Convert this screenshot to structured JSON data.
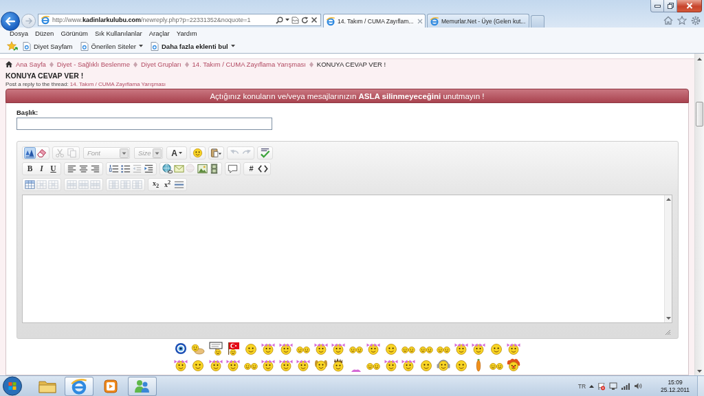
{
  "browser": {
    "back": {
      "disabled": false
    },
    "forward": {
      "disabled": true
    },
    "address": "http://www.**kadinlarkulubu.com**/newreply.php?p=22331352&noquote=1",
    "tabs": [
      {
        "label": "14. Takım / CUMA Zayıflam...",
        "selected": true
      },
      {
        "label": "Memurlar.Net - Üye (Gelen kut...",
        "selected": false
      }
    ],
    "menu": [
      "Dosya",
      "Düzen",
      "Görünüm",
      "Sık Kullanılanlar",
      "Araçlar",
      "Yardım"
    ],
    "favorites": [
      {
        "label": "Diyet Sayfam",
        "dropdown": false,
        "bold": false
      },
      {
        "label": "Önerilen Siteler",
        "dropdown": true,
        "bold": false
      },
      {
        "label": "Daha fazla eklenti bul",
        "dropdown": true,
        "bold": true
      }
    ]
  },
  "page": {
    "breadcrumb": [
      {
        "label": "Ana Sayfa",
        "current": false
      },
      {
        "label": "Diyet - Sağlıklı Beslenme",
        "current": false
      },
      {
        "label": "Diyet Grupları",
        "current": false
      },
      {
        "label": "14. Takım / CUMA Zayıflama Yarışması",
        "current": false
      },
      {
        "label": "KONUYA CEVAP VER !",
        "current": true
      }
    ],
    "title": "KONUYA CEVAP VER !",
    "subtitle": {
      "text": "Post a reply to the thread:",
      "link": "14. Takım / CUMA Zayıflama Yarışması"
    },
    "notice": "Açtığınız konuların ve/veya mesajlarınızın **ASLA silinmeyeceğini** unutmayın !",
    "form": {
      "title_label": "Başlık:"
    },
    "editor": {
      "toolbar": [
        [
          [
            {
              "kind": "mode",
              "on": true,
              "disabled": false
            },
            {
              "kind": "removeformat",
              "on": false,
              "disabled": false
            }
          ],
          [
            {
              "kind": "cut",
              "on": false,
              "disabled": true
            },
            {
              "kind": "copy",
              "on": false,
              "disabled": true
            }
          ],
          [
            {
              "kind": "font_select",
              "text": "Font",
              "on": false,
              "disabled": false
            }
          ],
          [
            {
              "kind": "size_select",
              "text": "Size",
              "on": false,
              "disabled": false
            }
          ],
          [
            {
              "kind": "color",
              "text": "A",
              "on": false,
              "disabled": false
            }
          ],
          [
            {
              "kind": "smiley",
              "on": false,
              "disabled": false
            }
          ],
          [
            {
              "kind": "paste",
              "on": false,
              "disabled": false
            }
          ],
          [
            {
              "kind": "undo",
              "on": false,
              "disabled": true
            },
            {
              "kind": "redo",
              "on": false,
              "disabled": true
            }
          ],
          [
            {
              "kind": "spellcheck",
              "on": false,
              "disabled": false
            }
          ]
        ],
        [
          [
            {
              "kind": "bold",
              "text": "B",
              "on": false,
              "disabled": false
            },
            {
              "kind": "italic",
              "text": "I",
              "on": false,
              "disabled": false
            },
            {
              "kind": "underline",
              "text": "U",
              "on": false,
              "disabled": false
            }
          ],
          [
            {
              "kind": "alignleft",
              "on": false,
              "disabled": false
            },
            {
              "kind": "aligncenter",
              "on": false,
              "disabled": false
            },
            {
              "kind": "alignright",
              "on": false,
              "disabled": false
            }
          ],
          [
            {
              "kind": "ol",
              "on": false,
              "disabled": false
            },
            {
              "kind": "ul",
              "on": false,
              "disabled": false
            },
            {
              "kind": "outdent",
              "on": false,
              "disabled": true
            },
            {
              "kind": "indent",
              "on": false,
              "disabled": false
            }
          ],
          [
            {
              "kind": "link",
              "on": false,
              "disabled": false
            },
            {
              "kind": "email",
              "on": false,
              "disabled": false
            },
            {
              "kind": "unlink",
              "on": false,
              "disabled": true
            },
            {
              "kind": "image",
              "on": false,
              "disabled": false
            },
            {
              "kind": "video",
              "on": false,
              "disabled": false
            }
          ],
          [
            {
              "kind": "quote",
              "on": false,
              "disabled": false
            }
          ],
          [
            {
              "kind": "code",
              "text": "#",
              "on": false,
              "disabled": false
            },
            {
              "kind": "html",
              "on": false,
              "disabled": false
            }
          ]
        ],
        [
          [
            {
              "kind": "table",
              "on": false,
              "disabled": false
            },
            {
              "kind": "table_cell",
              "on": false,
              "disabled": true
            },
            {
              "kind": "table_cell",
              "on": false,
              "disabled": true
            }
          ],
          [
            {
              "kind": "table_row",
              "on": false,
              "disabled": true
            },
            {
              "kind": "table_row",
              "on": false,
              "disabled": true
            },
            {
              "kind": "table_row",
              "on": false,
              "disabled": true
            }
          ],
          [
            {
              "kind": "table_col",
              "on": false,
              "disabled": true
            },
            {
              "kind": "table_col",
              "on": false,
              "disabled": true
            },
            {
              "kind": "table_col",
              "on": false,
              "disabled": true
            }
          ],
          [
            {
              "kind": "subscript",
              "text": "x$_{2}$",
              "on": false,
              "disabled": false
            },
            {
              "kind": "superscript",
              "text": "x$^{2}$",
              "on": false,
              "disabled": false
            },
            {
              "kind": "hr",
              "on": false,
              "disabled": false
            }
          ]
        ]
      ]
    },
    "smilies": [
      [
        {
          "kind": "nazar"
        },
        {
          "kind": "baby"
        },
        {
          "kind": "sign"
        },
        {
          "kind": "flag"
        },
        {
          "kind": "smiley"
        },
        {
          "kind": "bows"
        },
        {
          "kind": "bows"
        },
        {
          "kind": "pair"
        },
        {
          "kind": "bows"
        },
        {
          "kind": "bows"
        },
        {
          "kind": "pair"
        },
        {
          "kind": "bows"
        },
        {
          "kind": "smiley"
        },
        {
          "kind": "pair"
        },
        {
          "kind": "pair"
        },
        {
          "kind": "pair"
        },
        {
          "kind": "bows"
        },
        {
          "kind": "bows"
        },
        {
          "kind": "smiley"
        },
        {
          "kind": "bows"
        }
      ],
      [
        {
          "kind": "bows"
        },
        {
          "kind": "smiley"
        },
        {
          "kind": "bows"
        },
        {
          "kind": "bows"
        },
        {
          "kind": "pair"
        },
        {
          "kind": "bows"
        },
        {
          "kind": "bows"
        },
        {
          "kind": "bows"
        },
        {
          "kind": "dog"
        },
        {
          "kind": "crazy"
        },
        {
          "kind": "partial"
        },
        {
          "kind": "pair"
        },
        {
          "kind": "bows"
        },
        {
          "kind": "bows"
        },
        {
          "kind": "smiley"
        },
        {
          "kind": "headphones"
        },
        {
          "kind": "smiley"
        },
        {
          "kind": "carrot"
        },
        {
          "kind": "pair"
        },
        {
          "kind": "clown"
        }
      ]
    ]
  },
  "taskbar": {
    "apps": [
      {
        "kind": "folder",
        "running": false,
        "active": false
      },
      {
        "kind": "browser",
        "running": true,
        "active": true
      },
      {
        "kind": "media",
        "running": false,
        "active": false
      },
      {
        "kind": "messenger",
        "running": true,
        "active": false
      }
    ],
    "language": "TR",
    "time": "15:09",
    "date": "25.12.2011"
  }
}
